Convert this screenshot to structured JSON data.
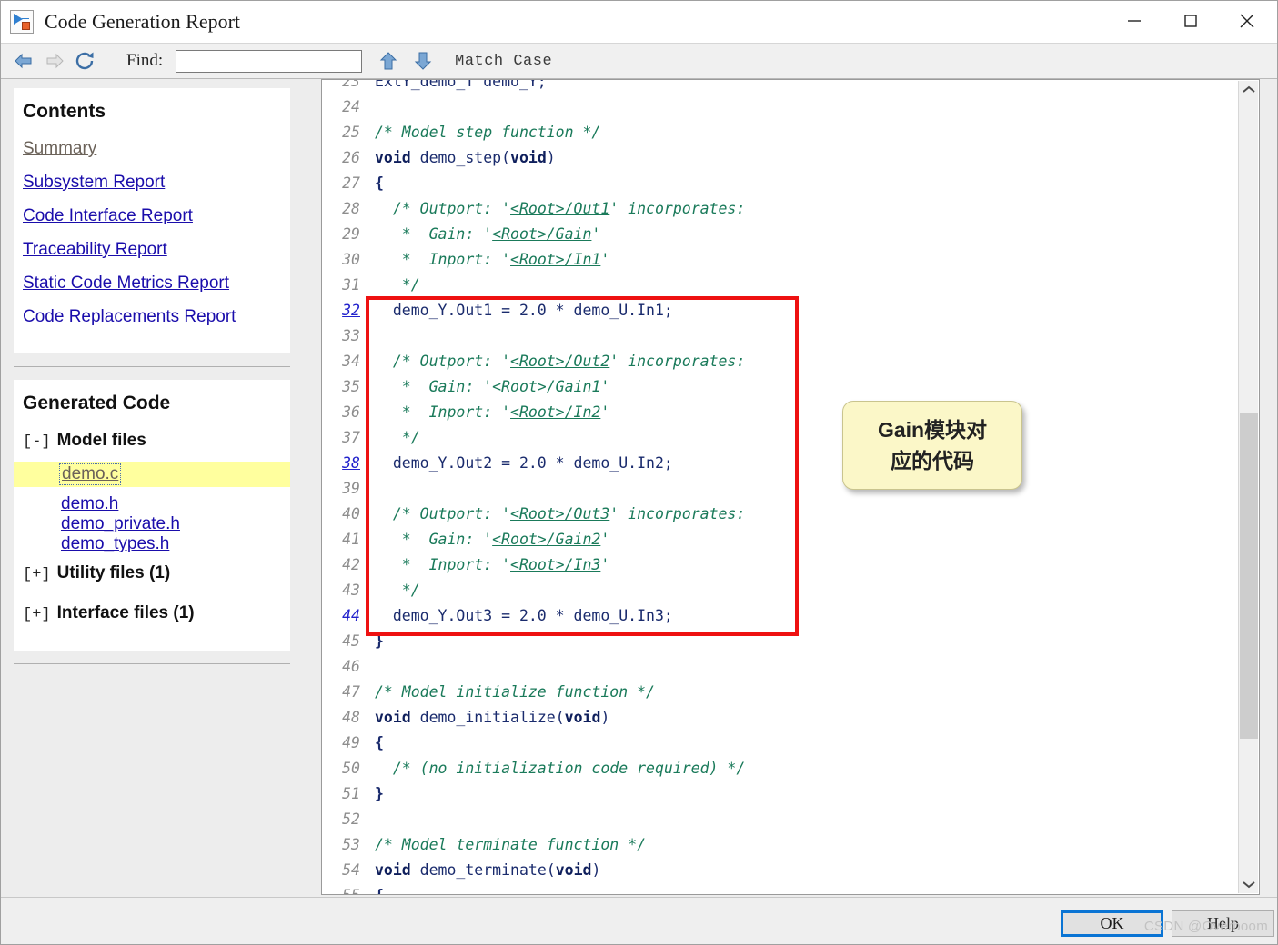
{
  "window": {
    "title": "Code Generation Report",
    "icon": "simulink-icon",
    "minimize_label": "—",
    "maximize_label": "□",
    "close_label": "✕"
  },
  "toolbar": {
    "back_icon": "back-arrow-icon",
    "forward_icon": "forward-arrow-icon",
    "refresh_icon": "refresh-icon",
    "find_label": "Find:",
    "find_value": "",
    "find_placeholder": "",
    "find_prev_icon": "up-arrow-icon",
    "find_next_icon": "down-arrow-icon",
    "match_case_label": "Match Case"
  },
  "sidebar": {
    "contents": {
      "title": "Contents",
      "links": [
        {
          "label": "Summary",
          "state": "visited"
        },
        {
          "label": "Subsystem Report",
          "state": "link"
        },
        {
          "label": "Code Interface Report",
          "state": "link"
        },
        {
          "label": "Traceability Report",
          "state": "link"
        },
        {
          "label": "Static Code Metrics Report",
          "state": "link"
        },
        {
          "label": "Code Replacements Report",
          "state": "link"
        }
      ]
    },
    "generated_code": {
      "title": "Generated Code",
      "groups": [
        {
          "toggle": "[-]",
          "label": "Model files",
          "files": [
            {
              "label": "demo.c",
              "selected": true
            },
            {
              "label": "demo.h",
              "selected": false
            },
            {
              "label": "demo_private.h",
              "selected": false
            },
            {
              "label": "demo_types.h",
              "selected": false
            }
          ]
        },
        {
          "toggle": "[+]",
          "label": "Utility files (1)",
          "files": []
        },
        {
          "toggle": "[+]",
          "label": "Interface files (1)",
          "files": []
        }
      ]
    }
  },
  "code": {
    "file": "demo.c",
    "first_visible_line": 23,
    "last_visible_line": 55,
    "lines": [
      {
        "n": "23",
        "anchor": false,
        "clipped": true,
        "tokens": [
          {
            "t": "code",
            "s": "ExtY_demo_T demo_Y;"
          }
        ]
      },
      {
        "n": "24",
        "anchor": false,
        "tokens": []
      },
      {
        "n": "25",
        "anchor": false,
        "tokens": [
          {
            "t": "cmt",
            "s": "/* Model step function */"
          }
        ]
      },
      {
        "n": "26",
        "anchor": false,
        "tokens": [
          {
            "t": "kw",
            "s": "void"
          },
          {
            "t": "code",
            "s": " demo_step("
          },
          {
            "t": "kw",
            "s": "void"
          },
          {
            "t": "code",
            "s": ")"
          }
        ]
      },
      {
        "n": "27",
        "anchor": false,
        "tokens": [
          {
            "t": "punc",
            "s": "{"
          }
        ]
      },
      {
        "n": "28",
        "anchor": false,
        "tokens": [
          {
            "t": "cmt",
            "s": "  /* Outport: '"
          },
          {
            "t": "link",
            "s": "<Root>/Out1"
          },
          {
            "t": "cmt",
            "s": "' incorporates:"
          }
        ]
      },
      {
        "n": "29",
        "anchor": false,
        "tokens": [
          {
            "t": "cmt",
            "s": "   *  Gain: '"
          },
          {
            "t": "link",
            "s": "<Root>/Gain"
          },
          {
            "t": "cmt",
            "s": "'"
          }
        ]
      },
      {
        "n": "30",
        "anchor": false,
        "tokens": [
          {
            "t": "cmt",
            "s": "   *  Inport: '"
          },
          {
            "t": "link",
            "s": "<Root>/In1"
          },
          {
            "t": "cmt",
            "s": "'"
          }
        ]
      },
      {
        "n": "31",
        "anchor": false,
        "tokens": [
          {
            "t": "cmt",
            "s": "   */"
          }
        ]
      },
      {
        "n": "32",
        "anchor": true,
        "tokens": [
          {
            "t": "code",
            "s": "  demo_Y.Out1 = 2.0 * demo_U.In1;"
          }
        ]
      },
      {
        "n": "33",
        "anchor": false,
        "tokens": []
      },
      {
        "n": "34",
        "anchor": false,
        "tokens": [
          {
            "t": "cmt",
            "s": "  /* Outport: '"
          },
          {
            "t": "link",
            "s": "<Root>/Out2"
          },
          {
            "t": "cmt",
            "s": "' incorporates:"
          }
        ]
      },
      {
        "n": "35",
        "anchor": false,
        "tokens": [
          {
            "t": "cmt",
            "s": "   *  Gain: '"
          },
          {
            "t": "link",
            "s": "<Root>/Gain1"
          },
          {
            "t": "cmt",
            "s": "'"
          }
        ]
      },
      {
        "n": "36",
        "anchor": false,
        "tokens": [
          {
            "t": "cmt",
            "s": "   *  Inport: '"
          },
          {
            "t": "link",
            "s": "<Root>/In2"
          },
          {
            "t": "cmt",
            "s": "'"
          }
        ]
      },
      {
        "n": "37",
        "anchor": false,
        "tokens": [
          {
            "t": "cmt",
            "s": "   */"
          }
        ]
      },
      {
        "n": "38",
        "anchor": true,
        "tokens": [
          {
            "t": "code",
            "s": "  demo_Y.Out2 = 2.0 * demo_U.In2;"
          }
        ]
      },
      {
        "n": "39",
        "anchor": false,
        "tokens": []
      },
      {
        "n": "40",
        "anchor": false,
        "tokens": [
          {
            "t": "cmt",
            "s": "  /* Outport: '"
          },
          {
            "t": "link",
            "s": "<Root>/Out3"
          },
          {
            "t": "cmt",
            "s": "' incorporates:"
          }
        ]
      },
      {
        "n": "41",
        "anchor": false,
        "tokens": [
          {
            "t": "cmt",
            "s": "   *  Gain: '"
          },
          {
            "t": "link",
            "s": "<Root>/Gain2"
          },
          {
            "t": "cmt",
            "s": "'"
          }
        ]
      },
      {
        "n": "42",
        "anchor": false,
        "tokens": [
          {
            "t": "cmt",
            "s": "   *  Inport: '"
          },
          {
            "t": "link",
            "s": "<Root>/In3"
          },
          {
            "t": "cmt",
            "s": "'"
          }
        ]
      },
      {
        "n": "43",
        "anchor": false,
        "tokens": [
          {
            "t": "cmt",
            "s": "   */"
          }
        ]
      },
      {
        "n": "44",
        "anchor": true,
        "tokens": [
          {
            "t": "code",
            "s": "  demo_Y.Out3 = 2.0 * demo_U.In3;"
          }
        ]
      },
      {
        "n": "45",
        "anchor": false,
        "tokens": [
          {
            "t": "punc",
            "s": "}"
          }
        ]
      },
      {
        "n": "46",
        "anchor": false,
        "tokens": []
      },
      {
        "n": "47",
        "anchor": false,
        "tokens": [
          {
            "t": "cmt",
            "s": "/* Model initialize function */"
          }
        ]
      },
      {
        "n": "48",
        "anchor": false,
        "tokens": [
          {
            "t": "kw",
            "s": "void"
          },
          {
            "t": "code",
            "s": " demo_initialize("
          },
          {
            "t": "kw",
            "s": "void"
          },
          {
            "t": "code",
            "s": ")"
          }
        ]
      },
      {
        "n": "49",
        "anchor": false,
        "tokens": [
          {
            "t": "punc",
            "s": "{"
          }
        ]
      },
      {
        "n": "50",
        "anchor": false,
        "tokens": [
          {
            "t": "cmt",
            "s": "  /* (no initialization code required) */"
          }
        ]
      },
      {
        "n": "51",
        "anchor": false,
        "tokens": [
          {
            "t": "punc",
            "s": "}"
          }
        ]
      },
      {
        "n": "52",
        "anchor": false,
        "tokens": []
      },
      {
        "n": "53",
        "anchor": false,
        "tokens": [
          {
            "t": "cmt",
            "s": "/* Model terminate function */"
          }
        ]
      },
      {
        "n": "54",
        "anchor": false,
        "tokens": [
          {
            "t": "kw",
            "s": "void"
          },
          {
            "t": "code",
            "s": " demo_terminate("
          },
          {
            "t": "kw",
            "s": "void"
          },
          {
            "t": "code",
            "s": ")"
          }
        ]
      },
      {
        "n": "55",
        "anchor": false,
        "clipped": true,
        "tokens": [
          {
            "t": "punc",
            "s": "{"
          }
        ]
      }
    ]
  },
  "annotation": {
    "callout_line1": "Gain模块对",
    "callout_line2": "应的代码",
    "highlight_color": "#ee1111",
    "callout_bg": "#fbf7c8"
  },
  "scrollbar": {
    "up_icon": "chevron-up-icon",
    "down_icon": "chevron-down-icon"
  },
  "footer": {
    "ok_label": "OK",
    "help_label": "Help",
    "watermark": "CSDN @Overboom"
  }
}
